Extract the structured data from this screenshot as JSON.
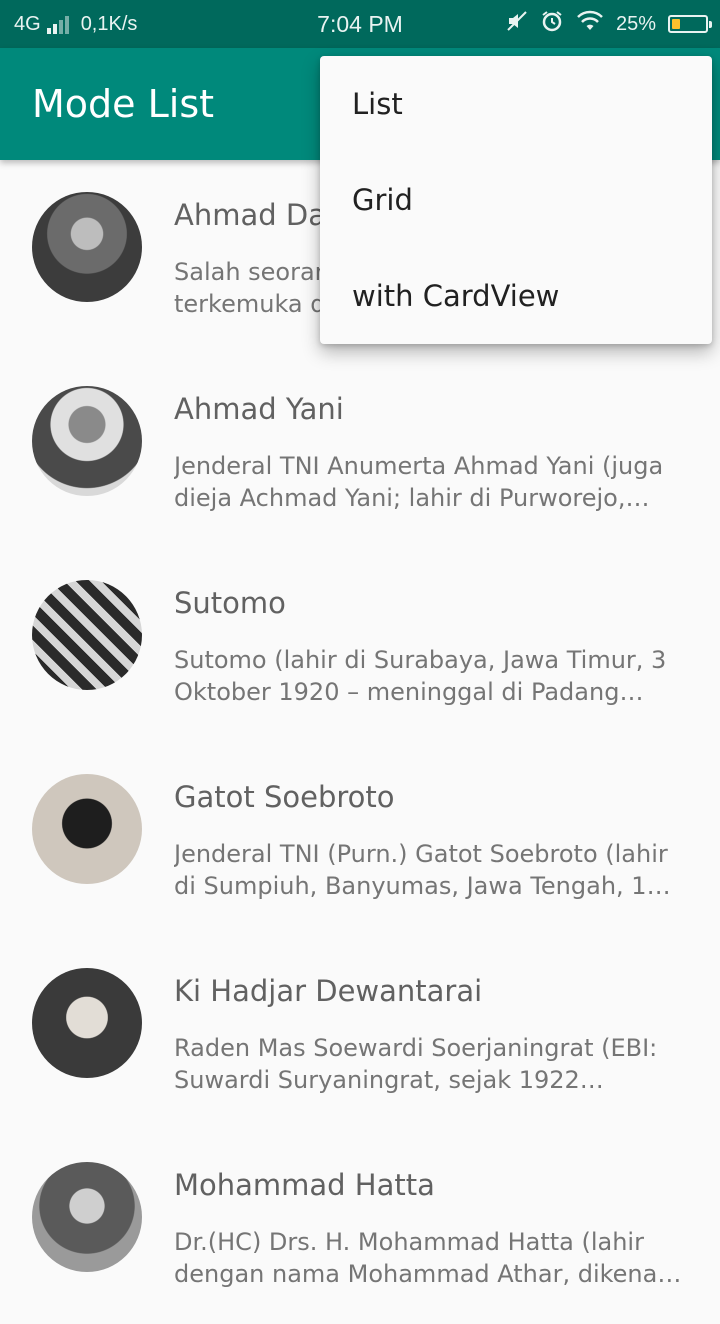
{
  "status_bar": {
    "network": "4G",
    "speed": "0,1K/s",
    "time": "7:04 PM",
    "battery_percent": "25%",
    "battery_level": 0.25,
    "icons": [
      "signal-icon",
      "mute-icon",
      "alarm-icon",
      "wifi-icon",
      "battery-icon"
    ]
  },
  "app_bar": {
    "title": "Mode List",
    "color": "#00897b"
  },
  "menu": {
    "items": [
      {
        "label": "List"
      },
      {
        "label": "Grid"
      },
      {
        "label": "with CardView"
      }
    ]
  },
  "heroes": [
    {
      "name": "Ahmad Dahlan",
      "description": "Salah seorang ulama dan khatib terkemuka di Masjid Besar Kasultanan Yogyakarta..."
    },
    {
      "name": "Ahmad Yani",
      "description": "Jenderal TNI Anumerta Ahmad Yani (juga dieja Achmad Yani; lahir di Purworejo, Jawa Tengah..."
    },
    {
      "name": "Sutomo",
      "description": "Sutomo (lahir di Surabaya, Jawa Timur, 3 Oktober 1920 – meninggal di Padang Arafah..."
    },
    {
      "name": "Gatot Soebroto",
      "description": "Jenderal TNI (Purn.) Gatot Soebroto (lahir di Sumpiuh, Banyumas, Jawa Tengah, 10 Oktober..."
    },
    {
      "name": "Ki Hadjar Dewantarai",
      "description": "Raden Mas Soewardi Soerjaningrat (EBI: Suwardi Suryaningrat, sejak 1922 menjadi Ki Hadjar..."
    },
    {
      "name": "Mohammad Hatta",
      "description": "Dr.(HC) Drs. H. Mohammad Hatta (lahir dengan nama Mohammad Athar, dikenal sebagai Bung Hatta..."
    }
  ]
}
